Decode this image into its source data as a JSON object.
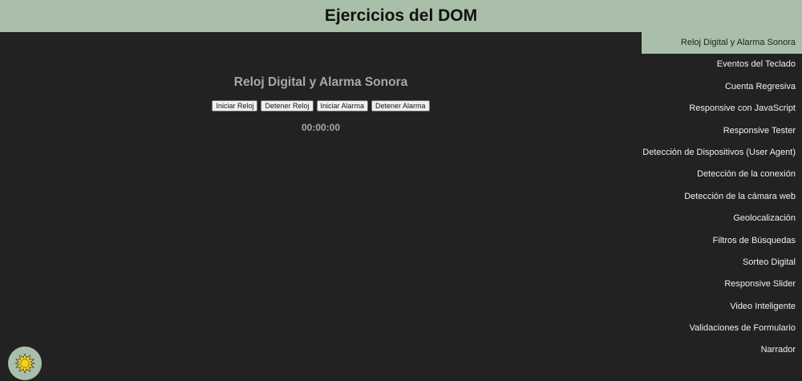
{
  "header": {
    "title": "Ejercicios del DOM"
  },
  "menu": {
    "items": [
      {
        "label": "Reloj Digital y Alarma Sonora",
        "active": true
      },
      {
        "label": "Eventos del Teclado"
      },
      {
        "label": "Cuenta Regresiva"
      },
      {
        "label": "Responsive con JavaScript"
      },
      {
        "label": "Responsive Tester"
      },
      {
        "label": "Detección de Dispositivos (User Agent)"
      },
      {
        "label": "Detección de la conexión"
      },
      {
        "label": "Detección de la cámara web"
      },
      {
        "label": "Geolocalización"
      },
      {
        "label": "Filtros de Búsquedas"
      },
      {
        "label": "Sorteo Digital"
      },
      {
        "label": "Responsive Slider"
      },
      {
        "label": "Video Inteligente"
      },
      {
        "label": "Validaciones de Formulario"
      },
      {
        "label": "Narrador"
      }
    ]
  },
  "section": {
    "title": "Reloj Digital y Alarma Sonora",
    "buttons": {
      "start_clock": "Iniciar Reloj",
      "stop_clock": "Detener Reloj",
      "start_alarm": "Iniciar Alarma",
      "stop_alarm": "Detener Alarma"
    },
    "clock_display": "00:00:00"
  },
  "theme_button": {
    "icon": "sun-icon"
  },
  "colors": {
    "accent": "#a9bfa9",
    "background": "#222222",
    "muted_text": "#a8a8a8",
    "sun": "#f4d21f"
  }
}
